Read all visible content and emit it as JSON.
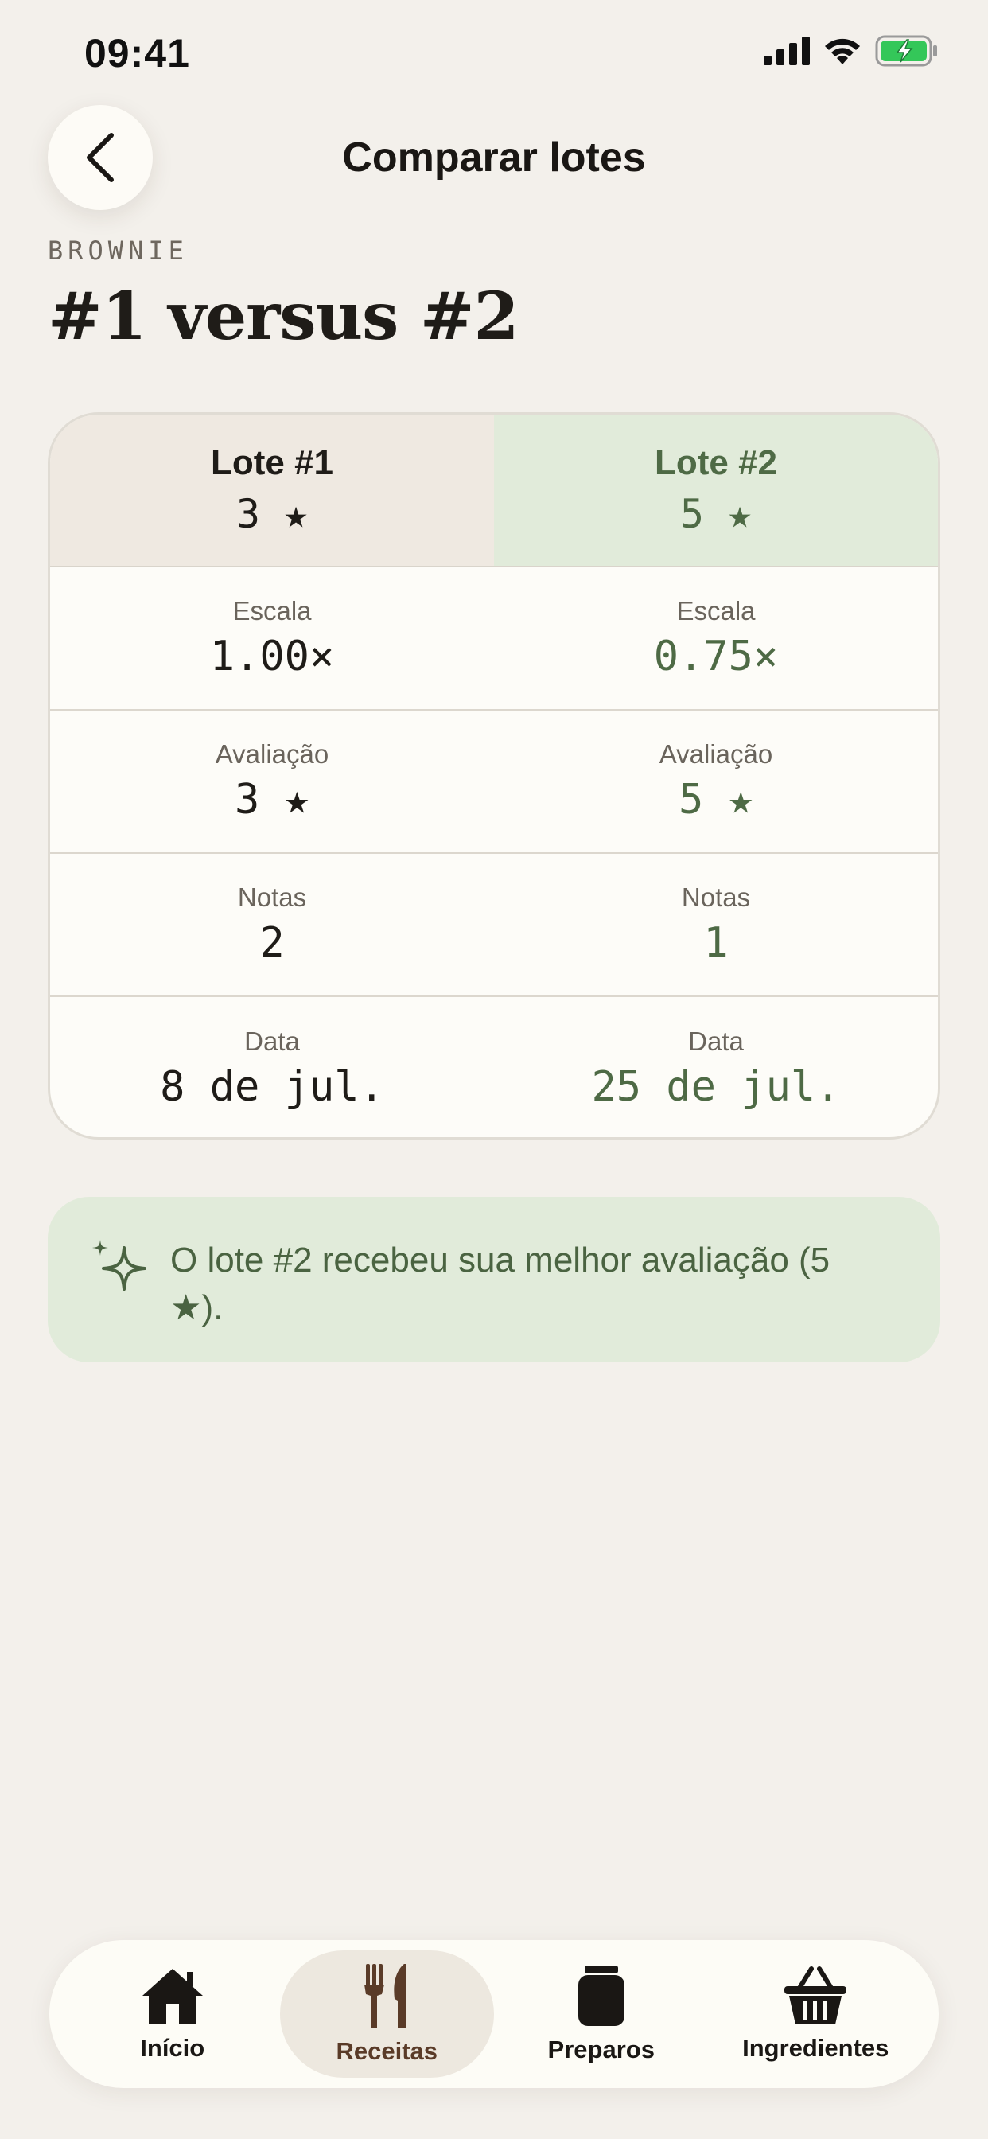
{
  "status_bar": {
    "time": "09:41"
  },
  "nav": {
    "title": "Comparar lotes"
  },
  "eyebrow": "BROWNIE",
  "heading": "#1 versus #2",
  "compare": {
    "left": {
      "label": "Lote #1",
      "rating": "3 ★"
    },
    "right": {
      "label": "Lote #2",
      "rating": "5 ★"
    },
    "rows": [
      {
        "label": "Escala",
        "left": "1.00×",
        "right": "0.75×"
      },
      {
        "label": "Avaliação",
        "left": "3 ★",
        "right": "5 ★"
      },
      {
        "label": "Notas",
        "left": "2",
        "right": "1"
      },
      {
        "label": "Data",
        "left": "8 de jul.",
        "right": "25 de jul."
      }
    ]
  },
  "insight": {
    "icon": "sparkle-icon",
    "text": "O lote #2 recebeu sua melhor avaliação (5 ★)."
  },
  "tabs": [
    {
      "label": "Início",
      "icon": "home-icon",
      "active": false
    },
    {
      "label": "Receitas",
      "icon": "fork-knife-icon",
      "active": true
    },
    {
      "label": "Preparos",
      "icon": "jar-icon",
      "active": false
    },
    {
      "label": "Ingredientes",
      "icon": "basket-icon",
      "active": false
    }
  ],
  "colors": {
    "background": "#f3f0eb",
    "accent_green": "#4e6a45",
    "green_tint": "#e1ebda",
    "beige_tint": "#efe9e1",
    "active_tab_text": "#5a3b28"
  }
}
